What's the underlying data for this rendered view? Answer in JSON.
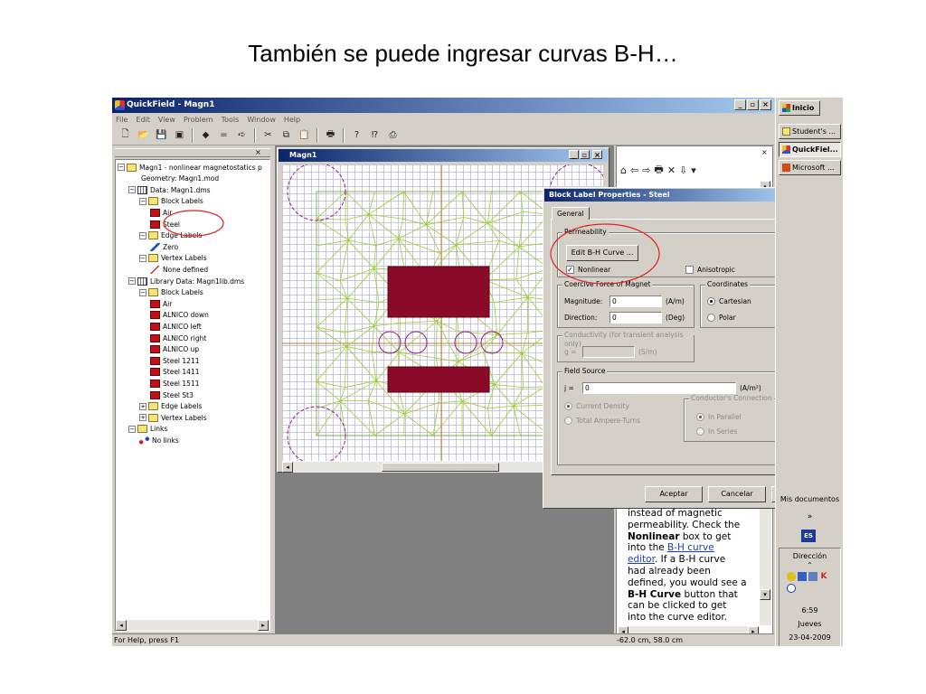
{
  "slide": {
    "title": "También se puede ingresar curvas B-H…"
  },
  "app": {
    "title": "QuickField - Magn1",
    "menu": [
      "File",
      "Edit",
      "View",
      "Problem",
      "Tools",
      "Window",
      "Help"
    ],
    "toolbar_icons": [
      "new-file-icon",
      "open-folder-icon",
      "save-icon",
      "save-all-icon",
      "geometry-icon",
      "equals-icon",
      "arrow-icon",
      "cut-icon",
      "copy-icon",
      "paste-icon",
      "print-icon",
      "help-icon",
      "context-help-icon",
      "about-icon"
    ],
    "tree": [
      {
        "label": "Magn1 - nonlinear magnetostatics p",
        "icon": "folder"
      },
      {
        "label": "Geometry: Magn1.mod",
        "icon": "geometry"
      },
      {
        "label": "Data: Magn1.dms",
        "icon": "grid"
      },
      {
        "label": "Block Labels",
        "icon": "folder"
      },
      {
        "label": "Air",
        "icon": "block"
      },
      {
        "label": "Steel",
        "icon": "block"
      },
      {
        "label": "Edge Labels",
        "icon": "folder"
      },
      {
        "label": "Zero",
        "icon": "edge"
      },
      {
        "label": "Vertex Labels",
        "icon": "folder"
      },
      {
        "label": "None defined",
        "icon": "line"
      },
      {
        "label": "Library Data: Magn1lib.dms",
        "icon": "grid"
      },
      {
        "label": "Block Labels",
        "icon": "folder"
      },
      {
        "label": "Air",
        "icon": "block"
      },
      {
        "label": "ALNICO down",
        "icon": "block"
      },
      {
        "label": "ALNICO left",
        "icon": "block"
      },
      {
        "label": "ALNICO right",
        "icon": "block"
      },
      {
        "label": "ALNICO up",
        "icon": "block"
      },
      {
        "label": "Steel 1211",
        "icon": "block"
      },
      {
        "label": "Steel 1411",
        "icon": "block"
      },
      {
        "label": "Steel 1511",
        "icon": "block"
      },
      {
        "label": "Steel St3",
        "icon": "block"
      },
      {
        "label": "Edge Labels",
        "icon": "folder"
      },
      {
        "label": "Vertex Labels",
        "icon": "folder"
      },
      {
        "label": "Links",
        "icon": "folder"
      },
      {
        "label": "No links",
        "icon": "links"
      }
    ],
    "child_window_title": "Magn1",
    "statusbar": {
      "left": "For Help, press F1",
      "coords": "-62.0 cm, 58.0 cm"
    }
  },
  "dialog": {
    "title": "Block Label Properties - Steel",
    "tab": "General",
    "permeability": {
      "title": "Permeability",
      "button": "Edit B-H Curve ...",
      "nonlinear": "Nonlinear",
      "nonlinear_checked": true,
      "anisotropic": "Anisotropic"
    },
    "coercive": {
      "title": "Coercive Force of Magnet",
      "magnitude_label": "Magnitude:",
      "magnitude_value": "0",
      "magnitude_unit": "(A/m)",
      "direction_label": "Direction:",
      "direction_value": "0",
      "direction_unit": "(Deg)"
    },
    "coordinates": {
      "title": "Coordinates",
      "cartesian": "Cartesian",
      "polar": "Polar"
    },
    "conductivity": {
      "title": "Conductivity (for transient analysis only)",
      "label": "g =",
      "unit": "(S/m)"
    },
    "field_source": {
      "title": "Field Source",
      "label": "j =",
      "value": "0",
      "unit": "(A/m²)",
      "current_density": "Current Density",
      "total_ampere_turns": "Total Ampere-Turns"
    },
    "connection": {
      "title": "Conductor's Connection",
      "parallel": "In Parallel",
      "series": "In Series"
    },
    "ok": "Aceptar",
    "cancel": "Cancelar"
  },
  "help_panel": {
    "icons": [
      "home-icon",
      "back-icon",
      "forward-icon",
      "print-icon",
      "close-icon",
      "download-icon",
      "dropdown-icon"
    ],
    "line1": "instead of magnetic",
    "line2": "permeability. Check the",
    "bold1": "Nonlinear",
    "line3": " box to get",
    "line4": "into the ",
    "link1": "B-H curve",
    "link2": "editor",
    "line5": ". If a B-H curve",
    "line6": "had already been",
    "line7": "defined, you would see a",
    "bold2": "B-H Curve",
    "line8": " button that",
    "line9": "can be clicked to get",
    "line10": "into the curve editor."
  },
  "taskbar": {
    "start": "Inicio",
    "items": [
      "Student's ...",
      "QuickFiel...",
      "Microsoft ..."
    ],
    "mis_documentos": "Mis documentos",
    "chevron": "»",
    "lang": "ES",
    "direccion": "Dirección",
    "time": "6:59",
    "day": "Jueves",
    "date": "23-04-2009"
  },
  "colors": {
    "mesh": "#9acd32",
    "block": "#8b0a2a",
    "circle": "#9a1a9a",
    "annotation": "#d22",
    "titlebar": "#0a246a"
  }
}
